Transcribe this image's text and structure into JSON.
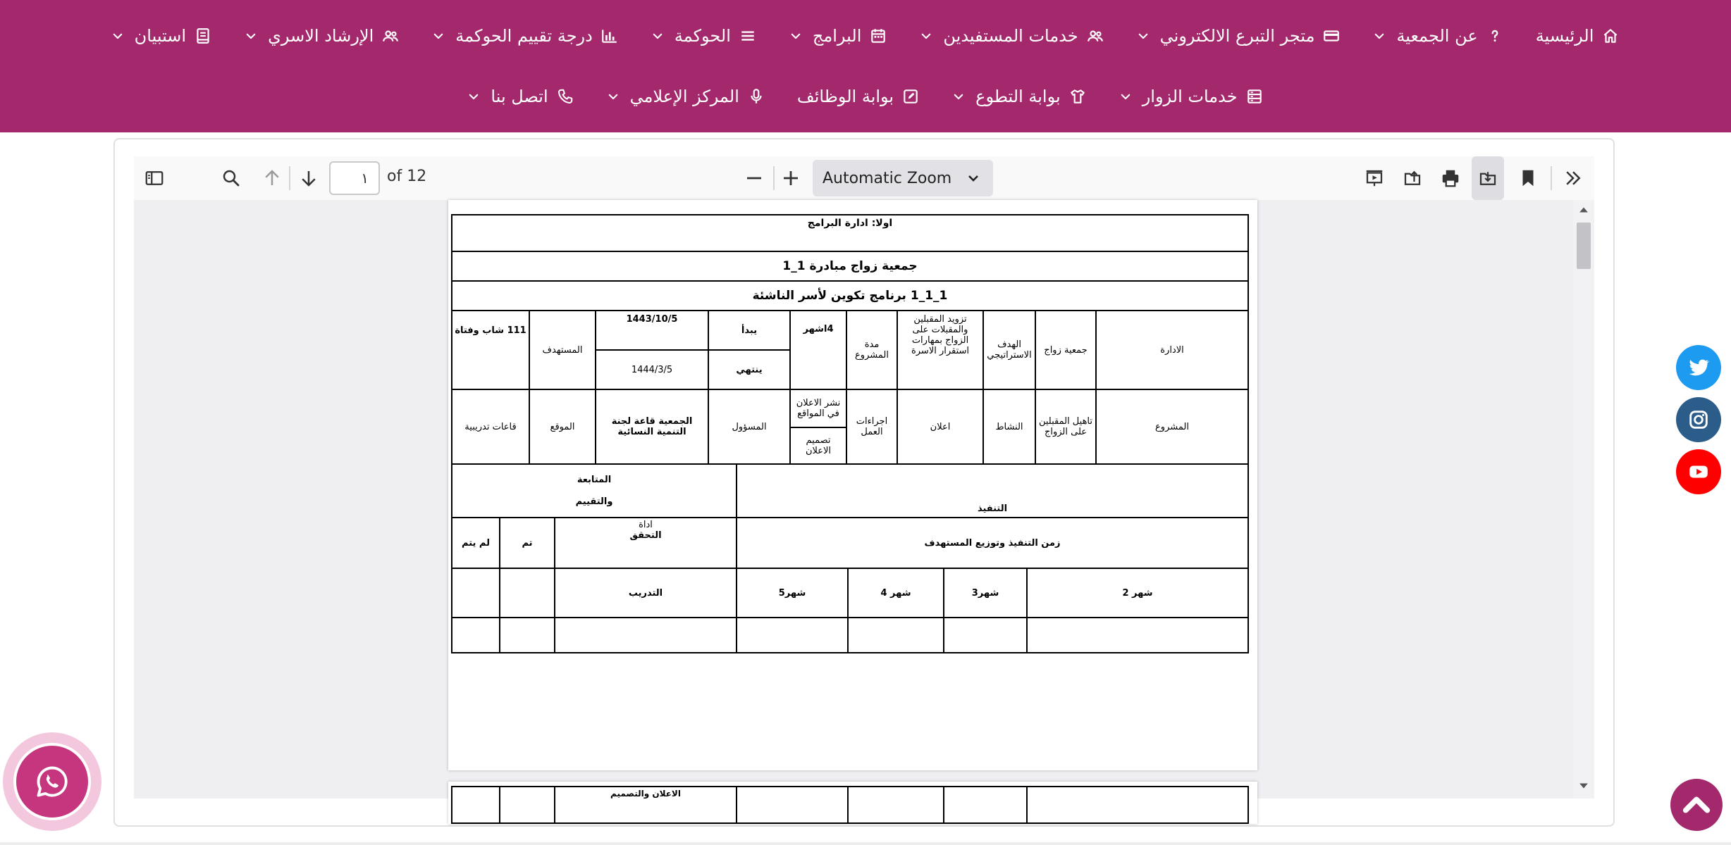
{
  "nav": {
    "row1": [
      {
        "id": "home",
        "label": "الرئيسية",
        "icon": "home-icon",
        "dropdown": false
      },
      {
        "id": "about",
        "label": "عن الجمعية",
        "icon": "question-icon",
        "dropdown": true
      },
      {
        "id": "donation-store",
        "label": "متجر التبرع الالكتروني",
        "icon": "card-icon",
        "dropdown": true
      },
      {
        "id": "beneficiary-services",
        "label": "خدمات المستفيدين",
        "icon": "users-icon",
        "dropdown": true
      },
      {
        "id": "programs",
        "label": "البرامج",
        "icon": "calendar-icon",
        "dropdown": true
      },
      {
        "id": "governance",
        "label": "الحوكمة",
        "icon": "list-icon",
        "dropdown": true
      },
      {
        "id": "governance-rating",
        "label": "درجة تقييم الحوكمة",
        "icon": "chart-icon",
        "dropdown": true
      },
      {
        "id": "family-guidance",
        "label": "الإرشاد الاسري",
        "icon": "users-icon",
        "dropdown": true
      },
      {
        "id": "surveys",
        "label": "استبيان",
        "icon": "book-icon",
        "dropdown": true
      }
    ],
    "row2": [
      {
        "id": "visitor-services",
        "label": "خدمات الزوار",
        "icon": "server-icon",
        "dropdown": true
      },
      {
        "id": "volunteer-portal",
        "label": "بوابة التطوع",
        "icon": "shirt-icon",
        "dropdown": true
      },
      {
        "id": "jobs-portal",
        "label": "بوابة الوظائف",
        "icon": "edit-icon",
        "dropdown": false
      },
      {
        "id": "media-center",
        "label": "المركز الإعلامي",
        "icon": "mic-icon",
        "dropdown": true
      },
      {
        "id": "contact",
        "label": "اتصل بنا",
        "icon": "phone-icon",
        "dropdown": true
      }
    ]
  },
  "viewer": {
    "page_value": "١",
    "page_count_label": "of 12",
    "zoom_label": "Automatic Zoom"
  },
  "document": {
    "title1": "اولا: ادارة البرامج",
    "title2": "جمعية زواج مبادرة 1_1",
    "title3": "1_1_1 برنامج تكوين لأسر الناشئة",
    "admin_label": "الادارة",
    "admin_value": "جمعية زواج",
    "goal_label": "الهدف الاستراتيجي",
    "goal_value": "تزويد المقبلين والمقبلات على الزواج بمهارات استقرار الاسرة",
    "project_duration_label": "مدة المشروع",
    "project_duration_value": "4اشهر",
    "start_label": "يبدأ",
    "start_value": "1443/10/5",
    "end_label": "ينتهي",
    "end_value": "1444/3/5",
    "beneficiary_label": "المستهدف",
    "beneficiary_value": "111 شاب وفتاة",
    "project_label": "المشروع",
    "project_value": "تاهيل المقبلين على الزواج",
    "activity_label": "النشاط",
    "activity_value": "اعلان",
    "procedures_label": "اجراءات العمل",
    "procedures_value_1": "نشر الاعلان في المواقع",
    "procedures_value_2": "تصميم الاعلان",
    "responsible_label": "المسؤول",
    "responsible_value": "الجمعية قاعة لجنة التنمية النسائية",
    "location_label": "الموقع",
    "location_value": "قاعات تدريبية",
    "execution_label": "التنفيذ",
    "followup_label_1": "المتابعة",
    "followup_label_2": "والتقييم",
    "timeline_label": "زمن التنفيذ وتوزيع المستهدف",
    "verify_label_1": "اداة",
    "verify_label_2": "التحقق",
    "done_label": "تم",
    "not_done_label": "لم يتم",
    "month2": "شهر 2",
    "month3": "شهر3",
    "month4": "شهر 4",
    "month5": "شهر5",
    "training_label": "التدريب",
    "page2_fragment": "الاعلان والتصميم"
  }
}
